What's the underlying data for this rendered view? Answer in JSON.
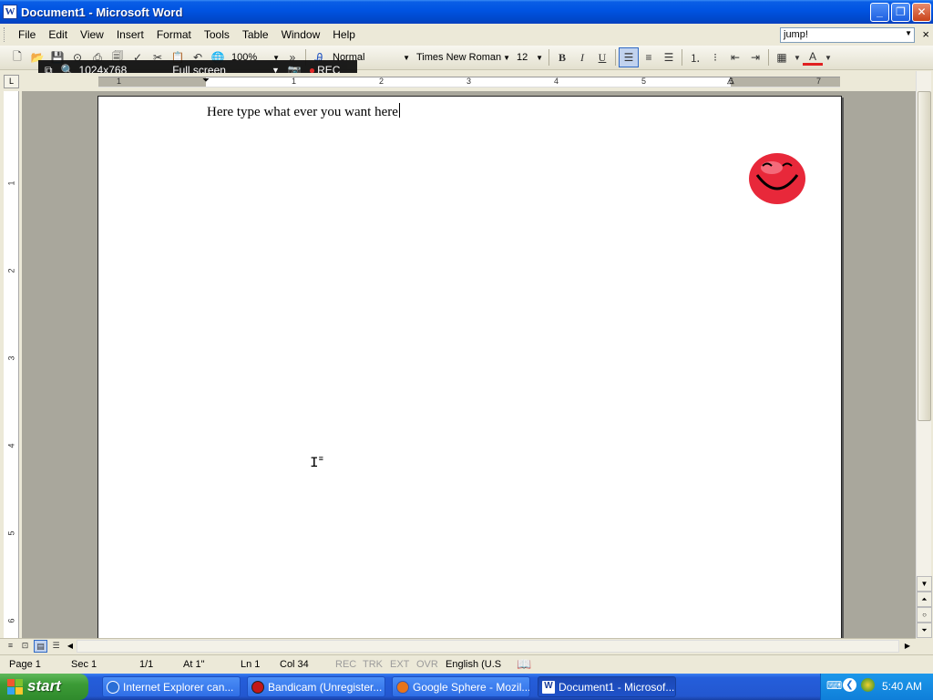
{
  "window": {
    "title": "Document1 - Microsoft Word",
    "app_icon": "W"
  },
  "menubar": {
    "items": [
      "File",
      "Edit",
      "View",
      "Insert",
      "Format",
      "Tools",
      "Table",
      "Window",
      "Help"
    ],
    "ask_question": "jump!"
  },
  "toolbar": {
    "zoom": "100%",
    "style": "Normal",
    "font": "Times New Roman",
    "font_size": "12",
    "bold_label": "B",
    "italic_label": "I",
    "underline_label": "U",
    "font_color": "#e02020"
  },
  "bandicam": {
    "resolution": "1024x768",
    "mode": "Full screen",
    "rec_label": "REC"
  },
  "ruler": {
    "numbers": [
      "1",
      "1",
      "2",
      "3",
      "4",
      "5",
      "6",
      "7"
    ],
    "vnumbers": [
      "1",
      "2",
      "3",
      "4",
      "5",
      "6"
    ]
  },
  "document": {
    "text": "Here type what ever you want here"
  },
  "statusbar": {
    "page": "Page 1",
    "section": "Sec 1",
    "page_of": "1/1",
    "at": "At 1\"",
    "line": "Ln 1",
    "col": "Col 34",
    "rec": "REC",
    "trk": "TRK",
    "ext": "EXT",
    "ovr": "OVR",
    "language": "English (U.S"
  },
  "taskbar": {
    "start": "start",
    "tasks": [
      {
        "label": "Internet Explorer can...",
        "icon": "ie-icon"
      },
      {
        "label": "Bandicam (Unregister...",
        "icon": "bandicam-icon"
      },
      {
        "label": "Google Sphere - Mozil...",
        "icon": "firefox-icon"
      },
      {
        "label": "Document1 - Microsof...",
        "icon": "word-icon"
      }
    ],
    "clock": "5:40 AM"
  }
}
